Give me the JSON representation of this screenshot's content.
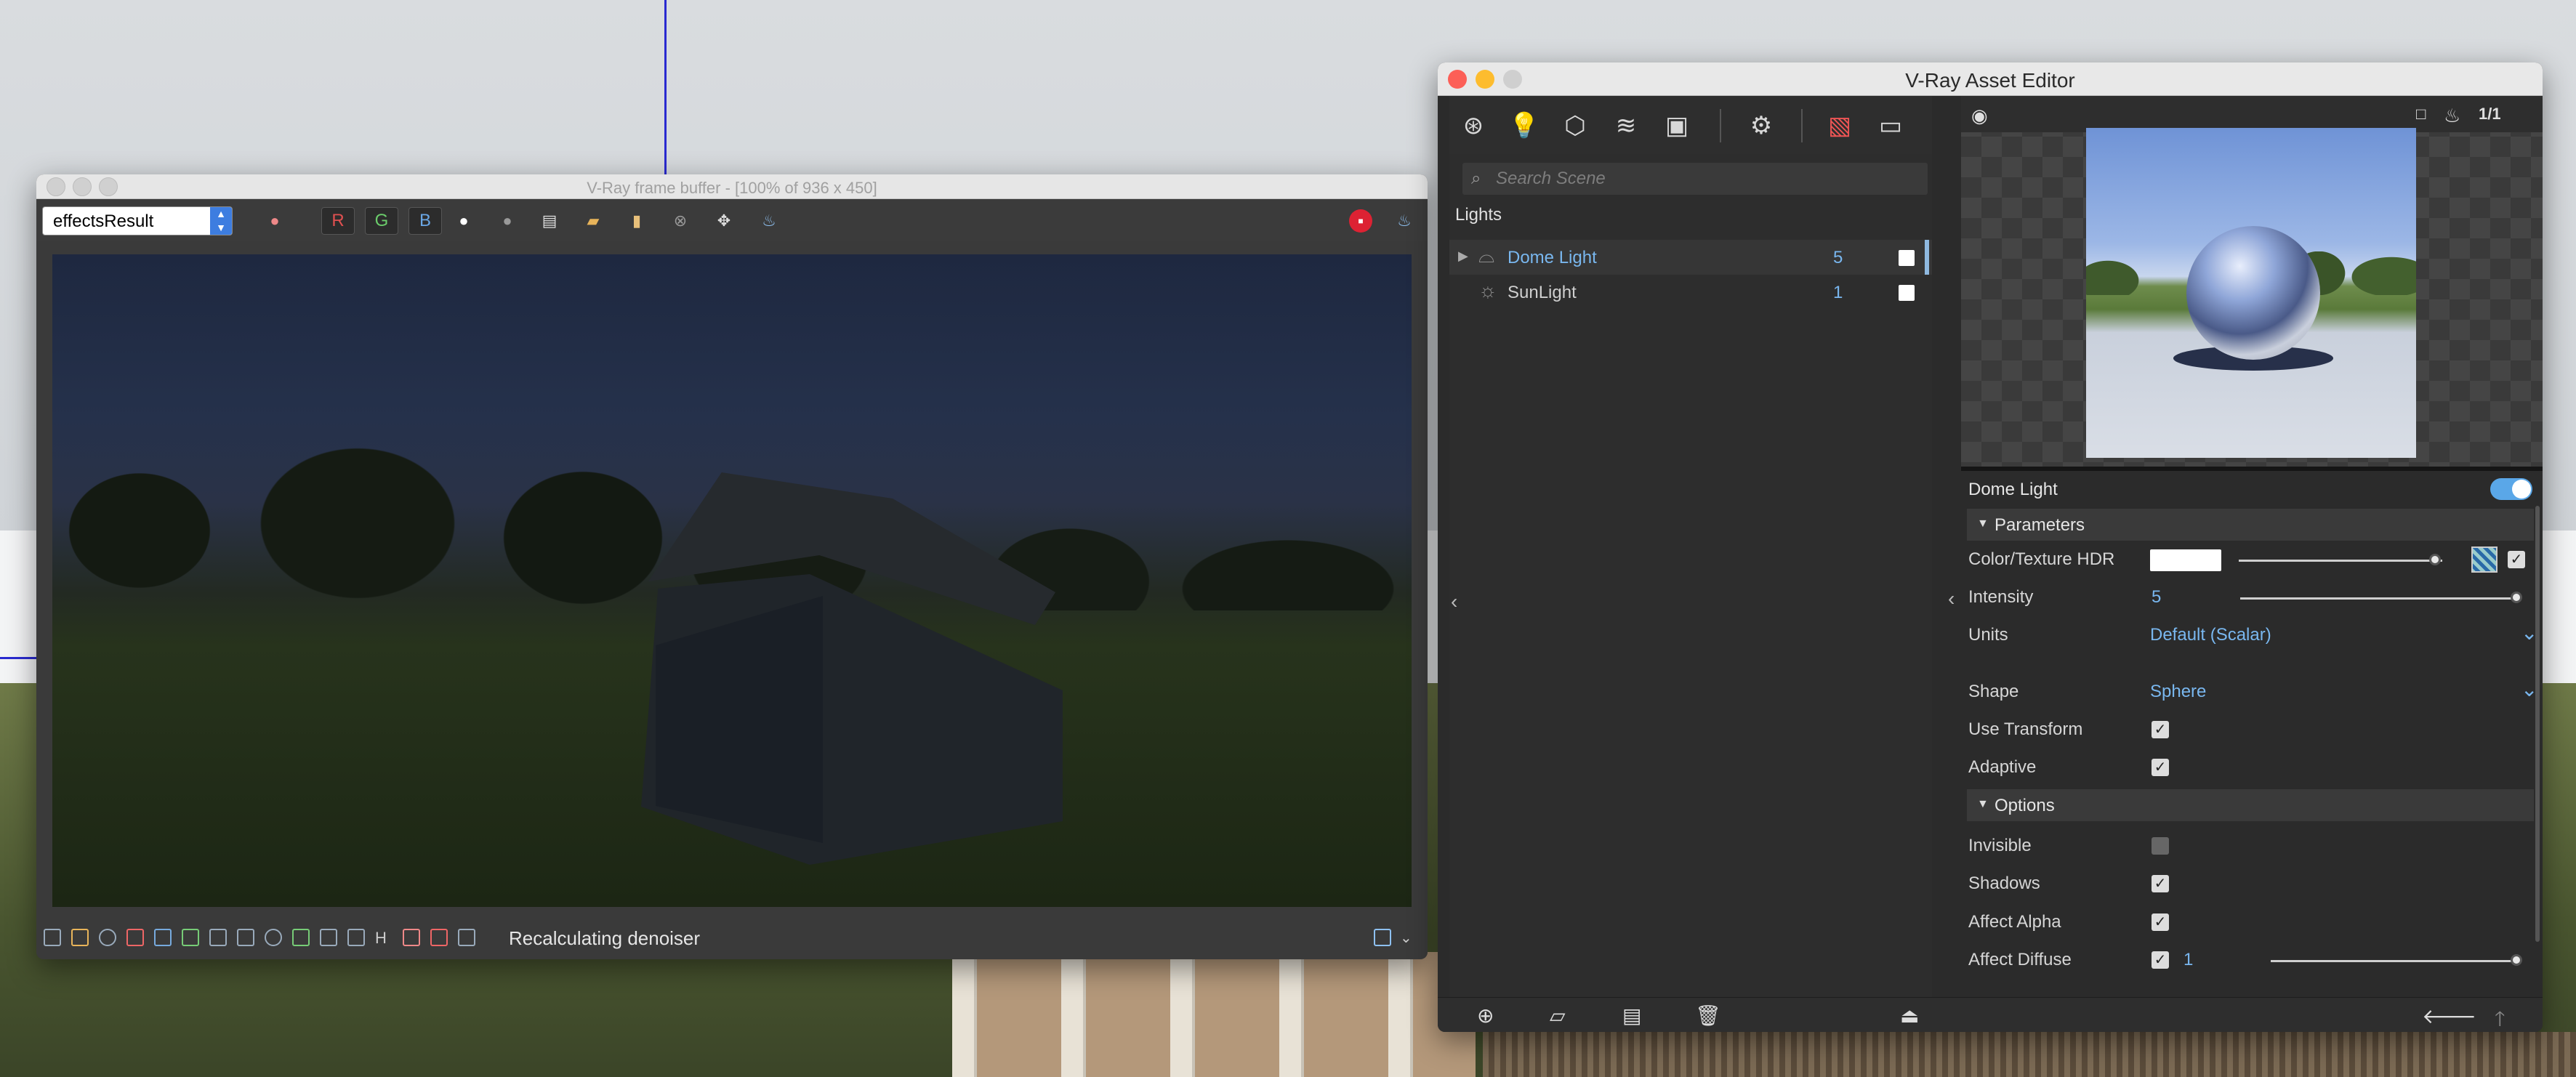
{
  "frame_buffer": {
    "title": "V-Ray frame buffer - [100% of 936 x 450]",
    "channel": "effectsResult",
    "rgb_buttons": {
      "r": "R",
      "g": "G",
      "b": "B"
    },
    "status": "Recalculating denoiser",
    "colors": {
      "r": "#e05050",
      "g": "#6bcc6b",
      "b": "#6aa7e6"
    }
  },
  "asset_editor": {
    "title": "V-Ray Asset Editor",
    "search_placeholder": "Search Scene",
    "category_heading": "Lights",
    "lights": [
      {
        "name": "Dome Light",
        "count": "5",
        "selected": true
      },
      {
        "name": "SunLight",
        "count": "1",
        "selected": false
      }
    ],
    "preview_ratio": "1/1",
    "selected_object": "Dome Light",
    "enabled": true,
    "sections": {
      "parameters": "Parameters",
      "options": "Options"
    },
    "params": {
      "color_texture": {
        "label": "Color/Texture HDR",
        "color": "#ffffff"
      },
      "intensity": {
        "label": "Intensity",
        "value": "5"
      },
      "units": {
        "label": "Units",
        "value": "Default (Scalar)"
      },
      "shape": {
        "label": "Shape",
        "value": "Sphere"
      },
      "use_transform": {
        "label": "Use Transform",
        "checked": true
      },
      "adaptive": {
        "label": "Adaptive",
        "checked": true
      }
    },
    "options": {
      "invisible": {
        "label": "Invisible",
        "checked": false
      },
      "shadows": {
        "label": "Shadows",
        "checked": true
      },
      "affect_alpha": {
        "label": "Affect Alpha",
        "checked": true
      },
      "affect_diffuse": {
        "label": "Affect Diffuse",
        "checked": true,
        "value": "1"
      }
    },
    "accent_color": "#5aa7e8"
  }
}
